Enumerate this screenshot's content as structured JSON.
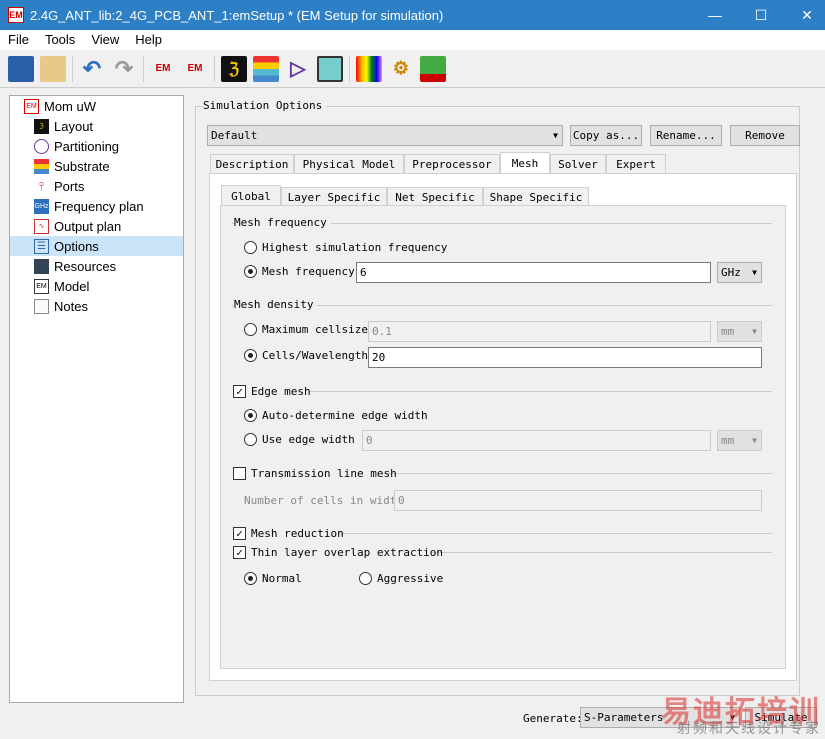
{
  "window": {
    "title": "2.4G_ANT_lib:2_4G_PCB_ANT_1:emSetup * (EM Setup for simulation)",
    "icon": "EM",
    "minimize": "—",
    "maximize": "☐",
    "close": "✕"
  },
  "menu": [
    "File",
    "Tools",
    "View",
    "Help"
  ],
  "toolbar": {
    "em": "EM"
  },
  "tree": {
    "root": "Mom uW",
    "items": [
      "Layout",
      "Partitioning",
      "Substrate",
      "Ports",
      "Frequency plan",
      "Output plan",
      "Options",
      "Resources",
      "Model",
      "Notes"
    ],
    "selected": "Options"
  },
  "sim": {
    "group": "Simulation Options",
    "preset": "Default",
    "copy": "Copy as...",
    "rename": "Rename...",
    "remove": "Remove",
    "tabs": [
      "Description",
      "Physical Model",
      "Preprocessor",
      "Mesh",
      "Solver",
      "Expert"
    ],
    "active_tab": "Mesh",
    "subtabs": [
      "Global",
      "Layer Specific",
      "Net Specific",
      "Shape Specific"
    ],
    "active_subtab": "Global"
  },
  "mesh": {
    "freq_group": "Mesh frequency",
    "highest": "Highest simulation frequency",
    "mesh_freq": "Mesh frequency",
    "mesh_freq_value": "6",
    "freq_unit": "GHz",
    "density_group": "Mesh density",
    "max_cell": "Maximum cellsize",
    "max_cell_value": "0.1",
    "max_cell_unit": "mm",
    "cells_wl": "Cells/Wavelength",
    "cells_wl_value": "20",
    "edge_mesh": "Edge mesh",
    "auto_edge": "Auto-determine edge width",
    "use_edge": "Use edge width",
    "edge_value": "0",
    "edge_unit": "mm",
    "tl_mesh": "Transmission line mesh",
    "num_cells": "Number of cells in width",
    "num_cells_value": "0",
    "reduction": "Mesh reduction",
    "thin_layer": "Thin layer overlap extraction",
    "normal": "Normal",
    "aggressive": "Aggressive"
  },
  "footer": {
    "generate_label": "Generate:",
    "generate_value": "S-Parameters",
    "simulate": "Simulate"
  },
  "watermark": {
    "line1": "易迪拓培训",
    "line2": "射频和天线设计专家"
  }
}
